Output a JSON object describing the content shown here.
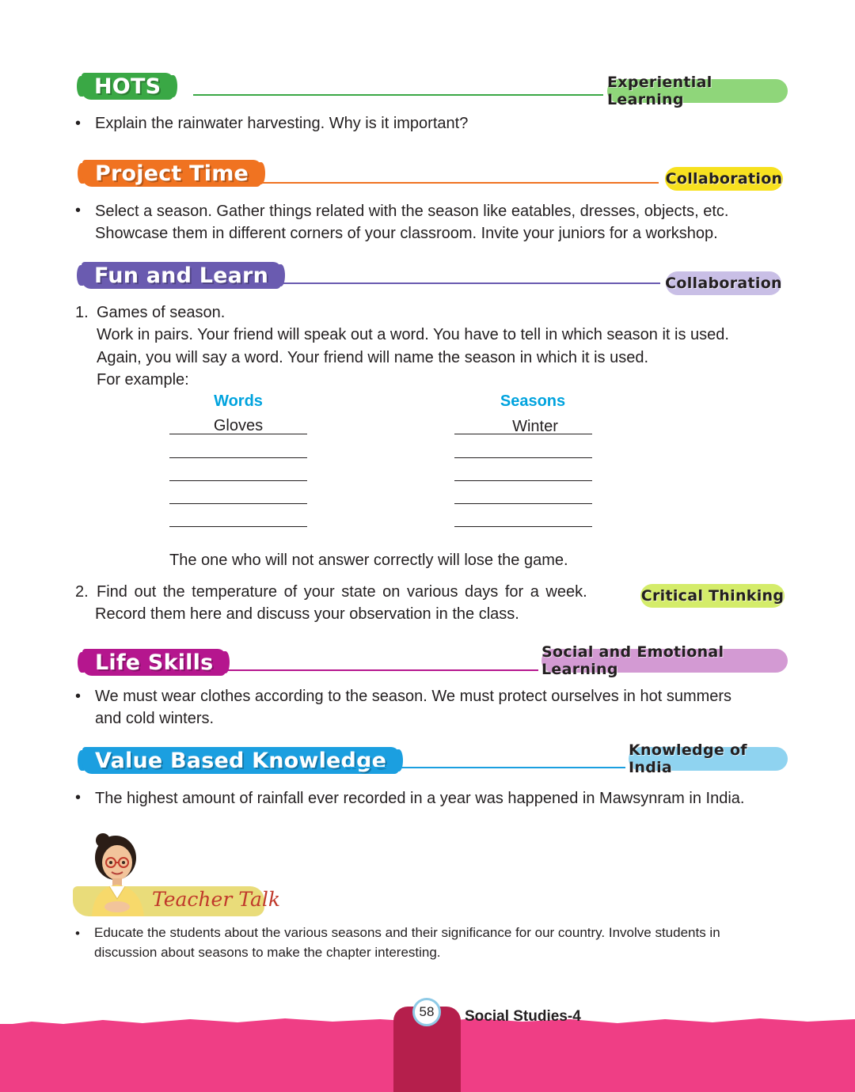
{
  "hots": {
    "label": "HOTS",
    "tag": "Experiential Learning",
    "bullet": "Explain the rainwater harvesting. Why is it important?",
    "color": "#3aa845",
    "tag_color": "#8fd67a"
  },
  "project": {
    "label": "Project Time",
    "tag": "Collaboration",
    "bullet_line1": "Select a season. Gather things related with the season like eatables, dresses, objects, etc.",
    "bullet_line2": "Showcase them in different corners of your classroom. Invite your juniors for a workshop.",
    "color": "#f07321",
    "tag_color": "#f7e11f"
  },
  "fun": {
    "label": "Fun and Learn",
    "tag": "Collaboration",
    "color": "#6a5bb0",
    "tag_color": "#c9bfe6",
    "item1_num": "1.",
    "item1_title": "Games of season.",
    "item1_line1": "Work in pairs. Your friend will speak out a word. You have to tell in which season it is used.",
    "item1_line2": "Again, you will say a word. Your friend will name the season in which it is used.",
    "item1_line3": "For example:",
    "col_words": "Words",
    "col_seasons": "Seasons",
    "example_word": "Gloves",
    "example_season": "Winter",
    "closing": "The one who will not answer correctly will lose the game.",
    "item2_num": "2.",
    "item2_line1": "Find out the temperature of your state on various days for a week.",
    "item2_line2": "Record them here and discuss your observation in the class.",
    "item2_tag": "Critical Thinking",
    "item2_tag_color": "#d4ec6a"
  },
  "life": {
    "label": "Life Skills",
    "tag": "Social and Emotional Learning",
    "bullet_line1": "We must wear clothes according to the season. We must protect ourselves in hot summers",
    "bullet_line2": "and cold winters.",
    "color": "#b5168e",
    "tag_color": "#d39ad3"
  },
  "value": {
    "label": "Value Based Knowledge",
    "tag": "Knowledge of India",
    "bullet": "The highest amount of rainfall ever recorded in a year was happened in Mawsynram in India.",
    "color": "#1b9fe0",
    "tag_color": "#8fd3f0"
  },
  "teacher": {
    "label": "Teacher Talk",
    "line1": "Educate the students about the various seasons and their significance for our country. Involve students in",
    "line2": "discussion about seasons to make the chapter interesting."
  },
  "footer": {
    "page_number": "58",
    "book": "Social Studies-4"
  }
}
